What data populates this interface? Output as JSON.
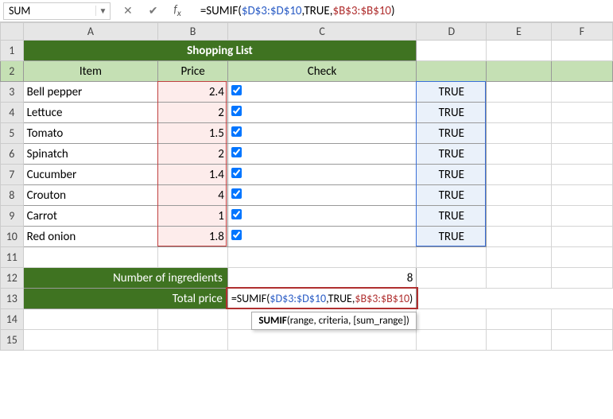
{
  "name_box": "SUM",
  "formula_segments": [
    {
      "t": "=SUMIF(",
      "c": "seg-black"
    },
    {
      "t": "$D$3:$D$10",
      "c": "seg-blue"
    },
    {
      "t": ",TRUE,",
      "c": "seg-black"
    },
    {
      "t": "$B$3:$B$10",
      "c": "seg-red"
    },
    {
      "t": ")",
      "c": "seg-black"
    }
  ],
  "cell_formula_segments": [
    {
      "t": "=SU",
      "c": "seg-black"
    },
    {
      "t": "MIF(",
      "c": "seg-black"
    },
    {
      "t": "$D$3:$D$10",
      "c": "seg-blue"
    },
    {
      "t": ",TRUE,",
      "c": "seg-black"
    },
    {
      "t": "$B$3:$B$10",
      "c": "seg-red"
    },
    {
      "t": ")",
      "c": "seg-black"
    }
  ],
  "columns": [
    "A",
    "B",
    "C",
    "D",
    "E",
    "F"
  ],
  "title": "Shopping List",
  "headers": {
    "item": "Item",
    "price": "Price",
    "check": "Check"
  },
  "items": [
    {
      "name": "Bell pepper",
      "price": "2.4",
      "d": "TRUE"
    },
    {
      "name": "Lettuce",
      "price": "2",
      "d": "TRUE"
    },
    {
      "name": "Tomato",
      "price": "1.5",
      "d": "TRUE"
    },
    {
      "name": "Spinatch",
      "price": "2",
      "d": "TRUE"
    },
    {
      "name": "Cucumber",
      "price": "1.4",
      "d": "TRUE"
    },
    {
      "name": "Crouton",
      "price": "4",
      "d": "TRUE"
    },
    {
      "name": "Carrot",
      "price": "1",
      "d": "TRUE"
    },
    {
      "name": "Red onion",
      "price": "1.8",
      "d": "TRUE"
    }
  ],
  "labels": {
    "num": "Number of ingredients",
    "total": "Total price"
  },
  "num_ingredients": "8",
  "tooltip": {
    "fn": "SUMIF",
    "sig": "(range, criteria, [sum_range])"
  },
  "chart_data": {
    "type": "table",
    "title": "Shopping List",
    "columns": [
      "Item",
      "Price",
      "Check",
      "D"
    ],
    "rows": [
      [
        "Bell pepper",
        2.4,
        true,
        "TRUE"
      ],
      [
        "Lettuce",
        2,
        true,
        "TRUE"
      ],
      [
        "Tomato",
        1.5,
        true,
        "TRUE"
      ],
      [
        "Spinatch",
        2,
        true,
        "TRUE"
      ],
      [
        "Cucumber",
        1.4,
        true,
        "TRUE"
      ],
      [
        "Crouton",
        4,
        true,
        "TRUE"
      ],
      [
        "Carrot",
        1,
        true,
        "TRUE"
      ],
      [
        "Red onion",
        1.8,
        true,
        "TRUE"
      ]
    ],
    "summary": {
      "Number of ingredients": 8,
      "Total price formula": "=SUMIF($D$3:$D$10,TRUE,$B$3:$B$10)"
    }
  }
}
